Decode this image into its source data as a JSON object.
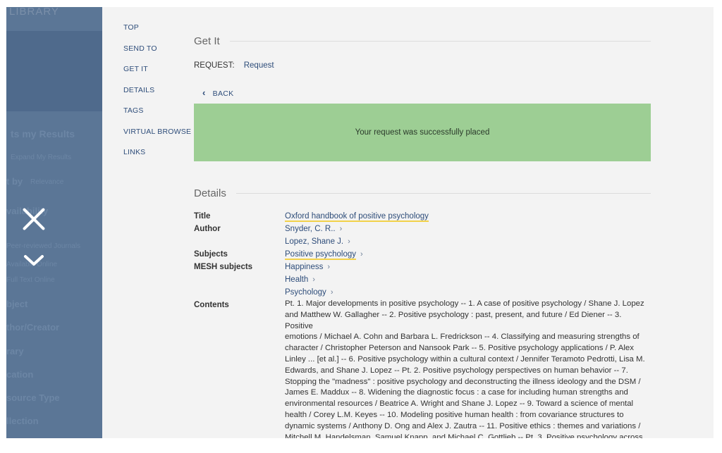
{
  "overlay": {
    "logo": "LIBRARY",
    "ghost_items": [
      "ts my Results",
      "Expand My Results",
      "t by",
      "Relevance",
      "vailability",
      "Peer-reviewed Journals",
      "Available Online",
      "Full Text Online",
      "bject",
      "thor/Creator",
      "rary",
      "cation",
      "source Type",
      "llection"
    ]
  },
  "nav": {
    "items": [
      "TOP",
      "SEND TO",
      "GET IT",
      "DETAILS",
      "TAGS",
      "VIRTUAL BROWSE",
      "LINKS"
    ]
  },
  "get_it": {
    "heading": "Get It",
    "request_label": "REQUEST:",
    "request_value": "Request",
    "back_label": "BACK",
    "success_message": "Your request was successfully placed"
  },
  "details": {
    "heading": "Details",
    "title_label": "Title",
    "title": "Oxford handbook of positive psychology",
    "author_label": "Author",
    "authors": [
      "Snyder, C. R..",
      "Lopez, Shane J."
    ],
    "subjects_label": "Subjects",
    "subjects": [
      "Positive psychology"
    ],
    "mesh_label": "MESH subjects",
    "mesh": [
      "Happiness",
      "Health",
      "Psychology"
    ],
    "contents_label": "Contents",
    "contents_lines": [
      "Pt. 1. Major developments in positive psychology -- 1. A case of positive psychology / Shane J. Lopez",
      "and Matthew W. Gallagher -- 2. Positive psychology : past, present, and future / Ed Diener -- 3. Positive",
      "emotions / Michael A. Cohn and Barbara L. Fredrickson -- 4. Classifying and measuring strengths of",
      "character / Christopher Peterson and Nansook Park -- 5. Positive psychology applications / P. Alex",
      "Linley ... [et al.] -- 6. Positive psychology within a cultural context / Jennifer Teramoto Pedrotti, Lisa M.",
      "Edwards, and Shane J. Lopez -- Pt. 2. Positive psychology perspectives on human behavior -- 7.",
      "Stopping the \"madness\" : positive psychology and deconstructing the illness ideology and the DSM /",
      "James E. Maddux -- 8. Widening the diagnostic focus : a case for including human strengths and",
      "environmental resources / Beatrice A. Wright and Shane J. Lopez -- 9. Toward a science of mental",
      "health / Corey L.M. Keyes -- 10. Modeling positive human health : from covariance structures to",
      "dynamic systems / Anthony D. Ong and Alex J. Zautra -- 11. Positive ethics : themes and variations /",
      "Mitchell M. Handelsman, Samuel Knapp, and Michael C. Gottlieb -- Pt. 3. Positive psychology across"
    ]
  },
  "colors": {
    "overlay": "#5b7696",
    "success": "#9dce94",
    "link": "#2e4d7a",
    "highlight": "#f2d24a"
  }
}
